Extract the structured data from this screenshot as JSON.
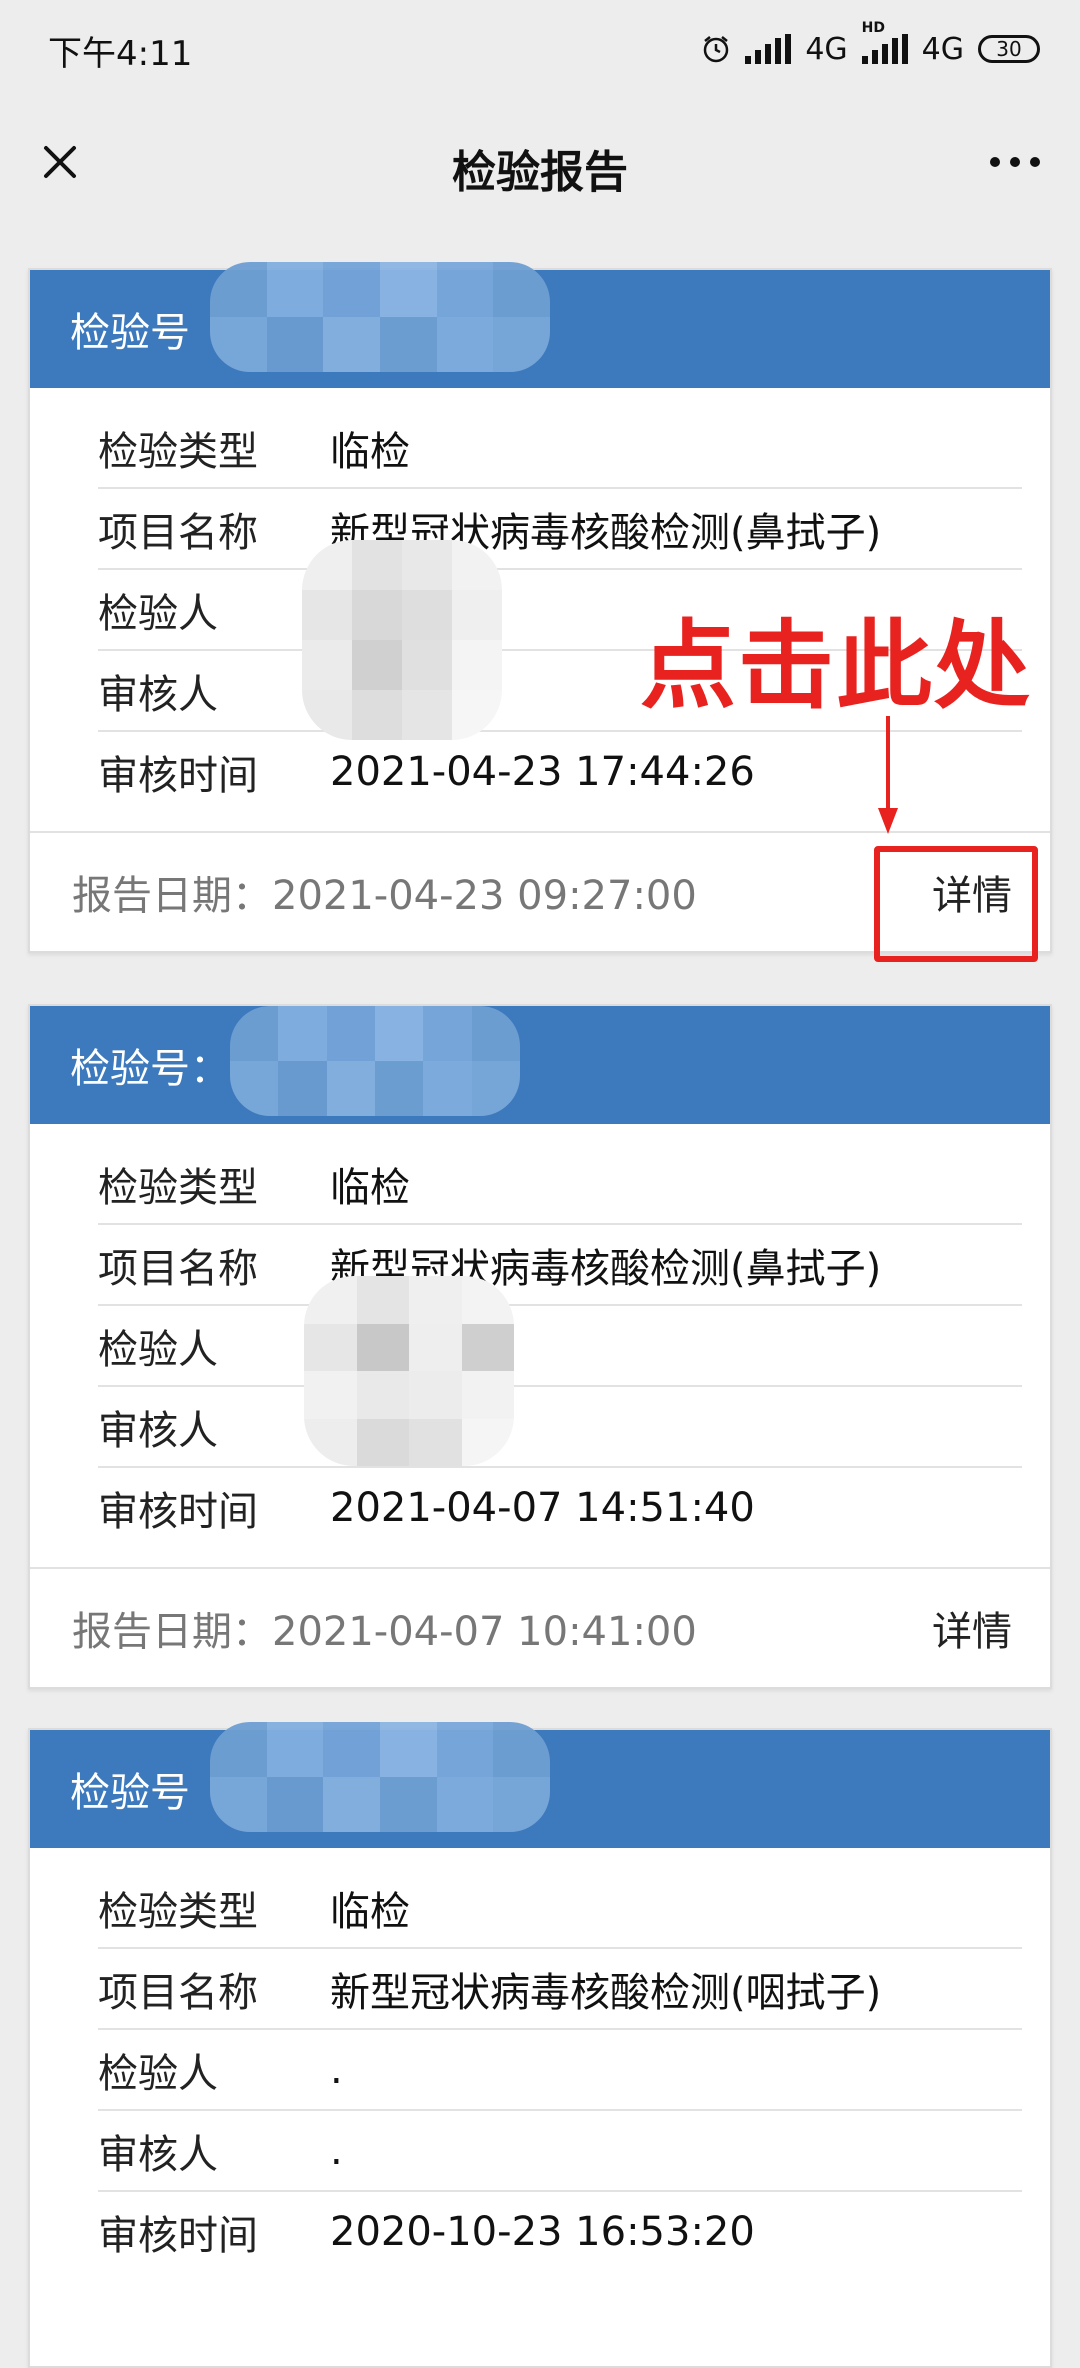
{
  "status_bar": {
    "time": "下午4:11",
    "network1": "4G",
    "network2": "4G",
    "hd_label": "HD",
    "battery": "30"
  },
  "nav": {
    "title": "检验报告",
    "close_icon": "close-icon",
    "more_icon": "more-icon"
  },
  "reports": [
    {
      "header_label": "检验号",
      "rows": [
        {
          "label": "检验类型",
          "value": "临检"
        },
        {
          "label": "项目名称",
          "value": "新型冠状病毒核酸检测(鼻拭子)"
        },
        {
          "label": "检验人",
          "value": ""
        },
        {
          "label": "审核人",
          "value": ""
        },
        {
          "label": "审核时间",
          "value": "2021-04-23 17:44:26"
        }
      ],
      "report_date": "报告日期：2021-04-23 09:27:00",
      "detail_label": "详情"
    },
    {
      "header_label": "检验号：",
      "rows": [
        {
          "label": "检验类型",
          "value": "临检"
        },
        {
          "label": "项目名称",
          "value": "新型冠状病毒核酸检测(鼻拭子)"
        },
        {
          "label": "检验人",
          "value": ""
        },
        {
          "label": "审核人",
          "value": ""
        },
        {
          "label": "审核时间",
          "value": "2021-04-07 14:51:40"
        }
      ],
      "report_date": "报告日期：2021-04-07 10:41:00",
      "detail_label": "详情"
    },
    {
      "header_label": "检验号",
      "rows": [
        {
          "label": "检验类型",
          "value": "临检"
        },
        {
          "label": "项目名称",
          "value": "新型冠状病毒核酸检测(咽拭子)"
        },
        {
          "label": "检验人",
          "value": "."
        },
        {
          "label": "审核人",
          "value": "."
        },
        {
          "label": "审核时间",
          "value": "2020-10-23 16:53:20"
        }
      ]
    }
  ],
  "annotation": {
    "text": "点击此处",
    "color": "#e8221f"
  },
  "colors": {
    "header_blue": "#3d79bd",
    "background": "#ededed"
  }
}
